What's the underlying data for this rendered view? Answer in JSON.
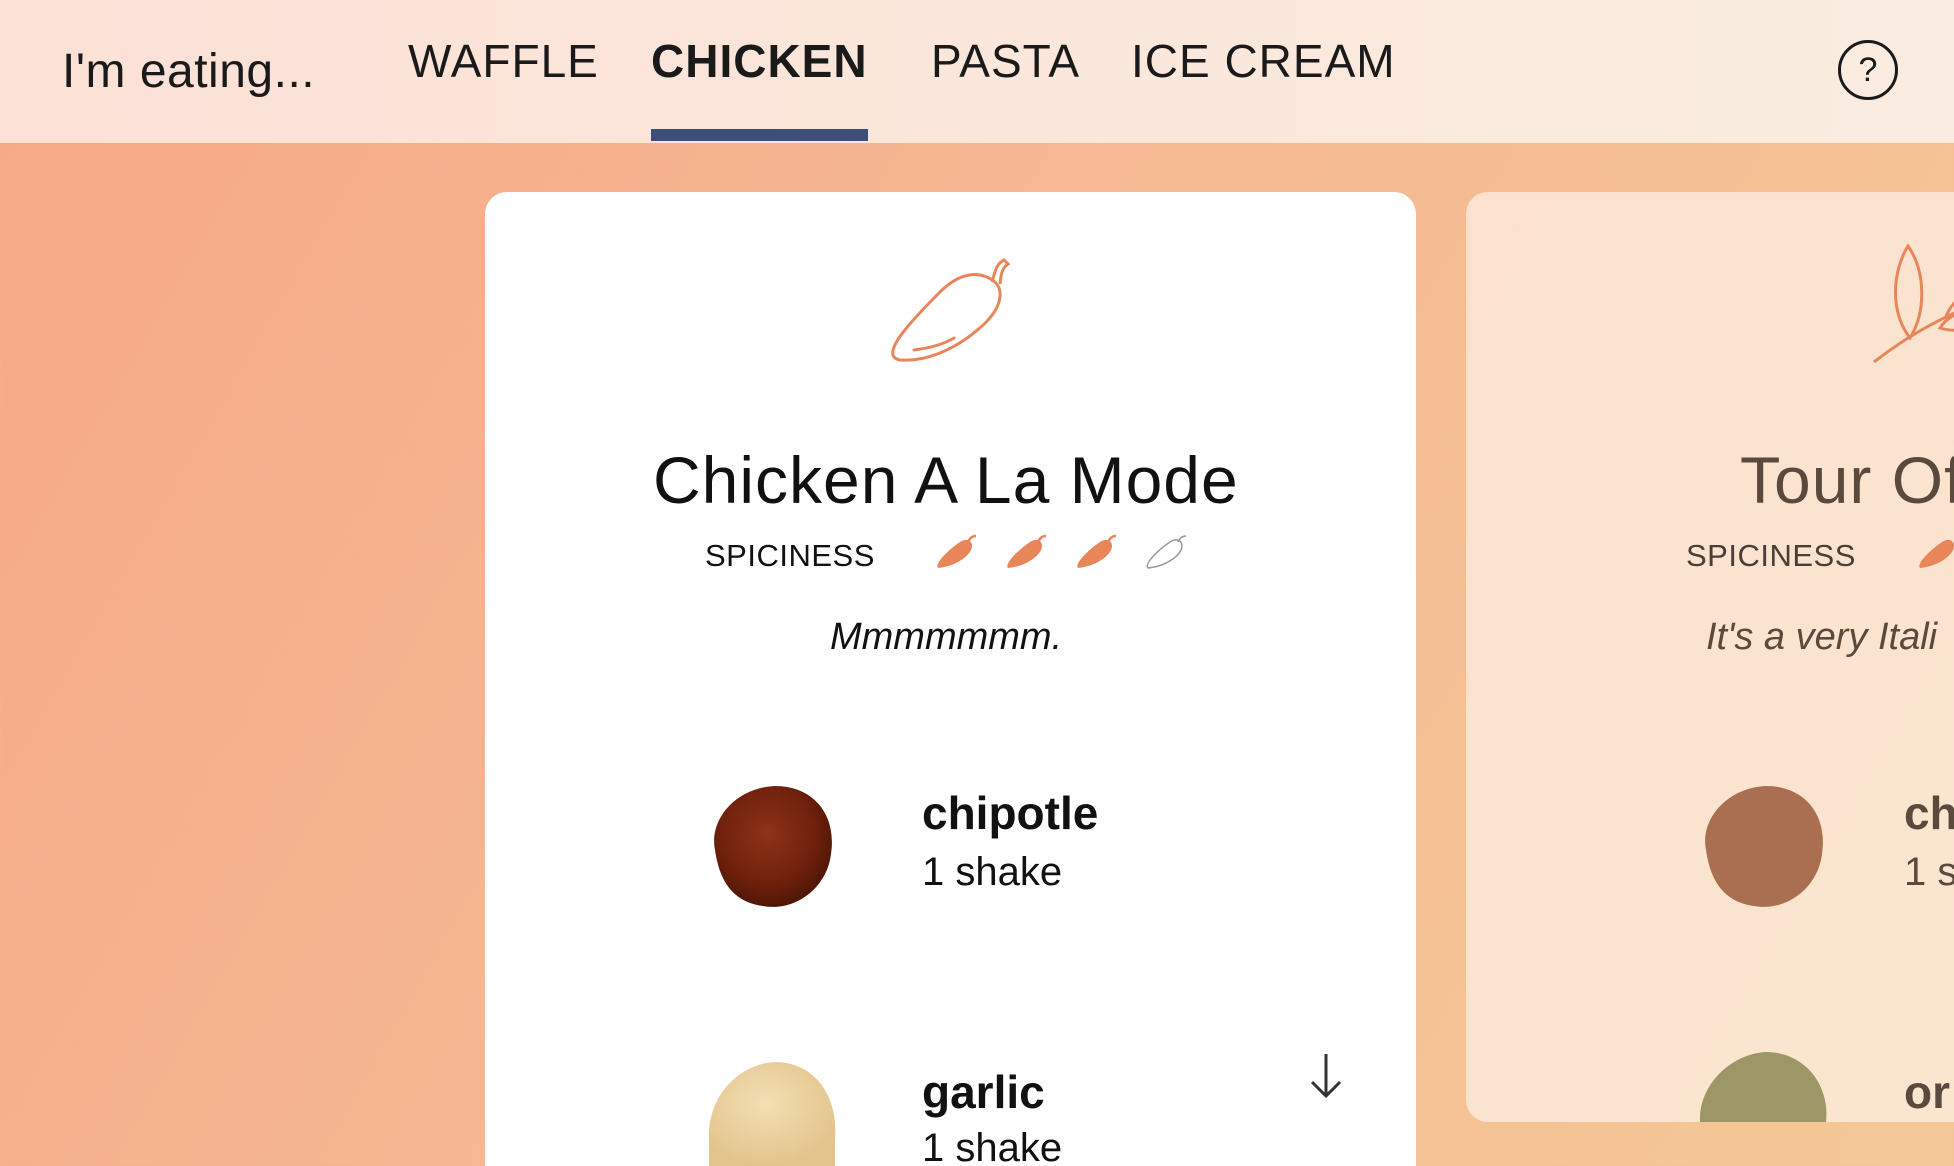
{
  "header": {
    "eating_label": "I'm eating...",
    "tabs": [
      {
        "label": "WAFFLE",
        "active": false
      },
      {
        "label": "CHICKEN",
        "active": true
      },
      {
        "label": "PASTA",
        "active": false
      },
      {
        "label": "ICE CREAM",
        "active": false
      }
    ],
    "help_label": "?",
    "active_tab_color": "#3b4f7a"
  },
  "cards": [
    {
      "icon": "chili-pepper-icon",
      "title": "Chicken A La Mode",
      "spiciness_label": "SPICINESS",
      "spiciness": 3,
      "spiciness_max": 4,
      "tagline": "Mmmmmmm.",
      "ingredients": [
        {
          "name": "chipotle",
          "qty": "1 shake",
          "color": "#7a2410"
        },
        {
          "name": "garlic",
          "qty": "1 shake",
          "color": "#ecd3a0"
        }
      ]
    },
    {
      "icon": "basil-leaf-icon",
      "title": "Tour Of",
      "spiciness_label": "SPICINESS",
      "tagline": "It's a very Itali",
      "ingredients": [
        {
          "name": "ch",
          "qty": "1 s",
          "color": "#9b5a3a"
        },
        {
          "name": "or",
          "qty": "",
          "color": "#8c8a55"
        }
      ]
    }
  ],
  "accent_color": "#e8865a"
}
